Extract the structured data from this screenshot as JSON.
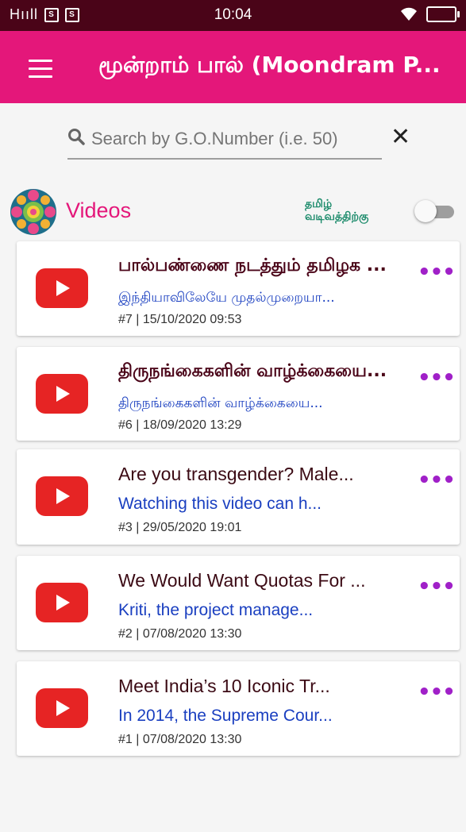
{
  "statusbar": {
    "signal": "Hııll",
    "sim1": "S",
    "sim2": "S",
    "time": "10:04",
    "wifi": "wifi-icon",
    "battery": "battery-icon"
  },
  "appbar": {
    "title": "மூன்றாம் பால் (Moondram P...",
    "menu_icon": "hamburger-menu-icon"
  },
  "search": {
    "placeholder": "Search by G.O.Number (i.e. 50)",
    "value": "",
    "clear": "✕"
  },
  "section": {
    "title": "Videos",
    "toggle_label_line1": "தமிழ்",
    "toggle_label_line2": "வடிவத்திற்கு",
    "toggle_on": false
  },
  "videos": [
    {
      "title": "பால்பண்ணை நடத்தும் தமிழக ...",
      "subtitle": "இந்தியாவிலேயே முதல்முறையா...",
      "meta": "#7 | 15/10/2020 09:53",
      "more": "•••"
    },
    {
      "title": "திருநங்கைகளின் வாழ்க்கையை...",
      "subtitle": "திருநங்கைகளின் வாழ்க்கையை...",
      "meta": "#6 | 18/09/2020 13:29",
      "more": "•••"
    },
    {
      "title": "Are you transgender? Male...",
      "subtitle": "Watching this video can h...",
      "meta": "#3 | 29/05/2020 19:01",
      "more": "•••"
    },
    {
      "title": "We Would Want Quotas For ...",
      "subtitle": "Kriti, the project manage...",
      "meta": "#2 | 07/08/2020 13:30",
      "more": "•••"
    },
    {
      "title": "Meet India’s 10 Iconic Tr...",
      "subtitle": "In 2014, the Supreme Cour...",
      "meta": "#1 | 07/08/2020 13:30",
      "more": "•••"
    }
  ],
  "colors": {
    "statusbar": "#4a0418",
    "appbar": "#e4177a",
    "accent": "#e4177a",
    "link": "#1a3fc0",
    "more": "#a020c8"
  }
}
